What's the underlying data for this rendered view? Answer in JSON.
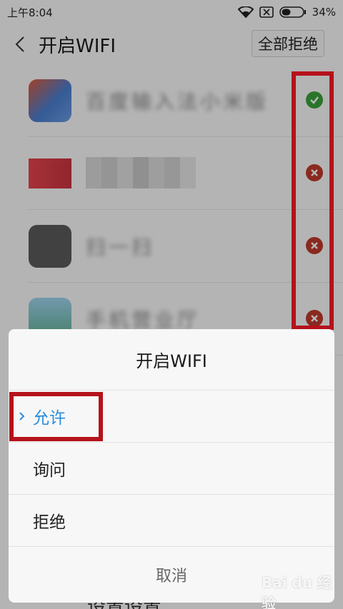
{
  "status_bar": {
    "time": "上午8:04",
    "battery": "34%"
  },
  "header": {
    "title": "开启WIFI",
    "reject_all": "全部拒绝"
  },
  "apps": [
    {
      "name": "百度输入法小米版",
      "state": "allow",
      "icon_colors": [
        "#4a7fd0",
        "#e05a3a"
      ]
    },
    {
      "name": "",
      "state": "deny",
      "icon_colors": [
        "#e8444e",
        "#c93440"
      ]
    },
    {
      "name": "扫一扫",
      "state": "deny",
      "icon_colors": [
        "#555555",
        "#777777"
      ]
    },
    {
      "name": "手机营业厅",
      "state": "deny",
      "icon_colors": [
        "#6fb8e3",
        "#77c0a0"
      ]
    }
  ],
  "dialog": {
    "title": "开启WIFI",
    "options": [
      "允许",
      "询问",
      "拒绝"
    ],
    "selected": "允许",
    "cancel": "取消"
  },
  "below": {
    "partial_text": "设置设置"
  },
  "watermark": "Bai du 经验",
  "colors": {
    "allow": "#3aa23a",
    "deny": "#c0392b",
    "accent": "#2a8de0",
    "highlight": "#b5121b"
  }
}
